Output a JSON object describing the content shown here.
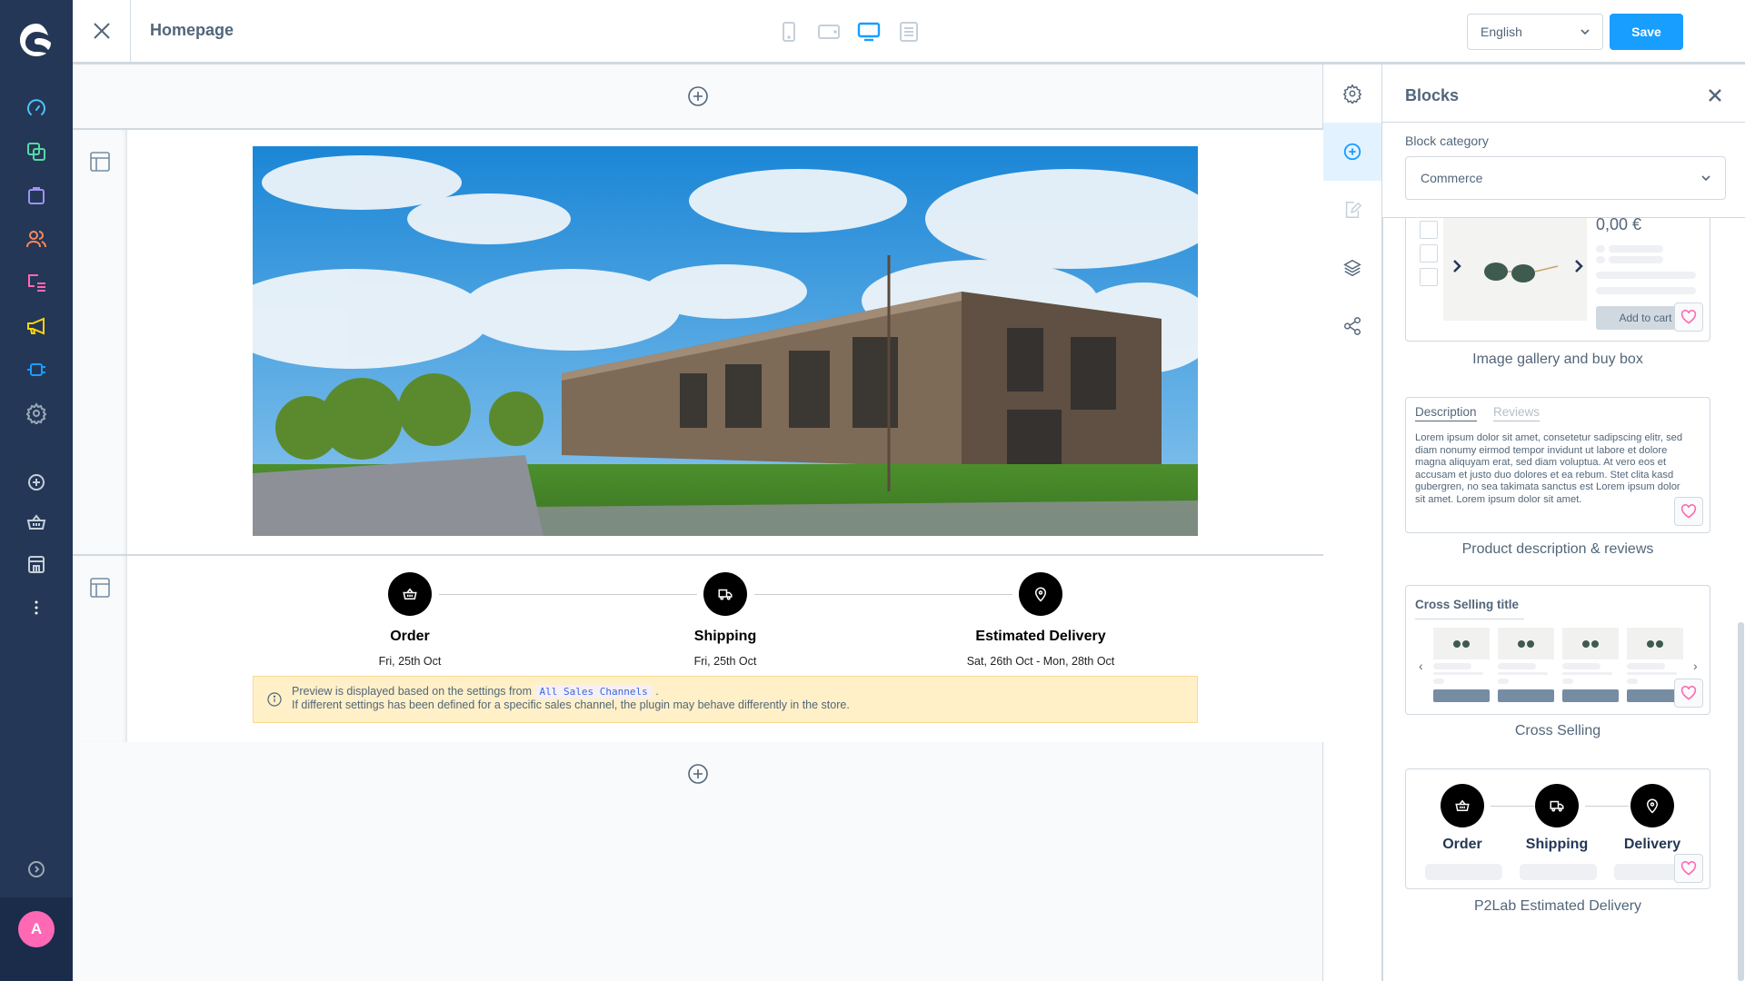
{
  "app": {
    "avatar_initial": "A",
    "brand_color": "#189eff"
  },
  "sidebar": {
    "items": [
      {
        "name": "dashboard",
        "icon": "gauge-icon",
        "color": "#4fc4f7"
      },
      {
        "name": "catalogues",
        "icon": "copy-icon",
        "color": "#57d9a3"
      },
      {
        "name": "orders",
        "icon": "shopping-bag-icon",
        "color": "#a092f0"
      },
      {
        "name": "customers",
        "icon": "users-icon",
        "color": "#ff885b"
      },
      {
        "name": "content",
        "icon": "content-icon",
        "color": "#ff68b4"
      },
      {
        "name": "marketing",
        "icon": "megaphone-icon",
        "color": "#ffd700"
      },
      {
        "name": "extensions",
        "icon": "plug-icon",
        "color": "#189eff"
      },
      {
        "name": "settings",
        "icon": "gear-icon",
        "color": "#9aa8b5"
      }
    ],
    "sales_channels": [
      {
        "name": "add-sales-channel",
        "icon": "plus-circle-icon"
      },
      {
        "name": "headless",
        "icon": "basket-icon"
      },
      {
        "name": "storefront",
        "icon": "storefront-icon"
      },
      {
        "name": "more",
        "icon": "more-vertical-icon"
      }
    ],
    "collapse_icon": "chevron-circle-right-icon"
  },
  "topbar": {
    "title": "Homepage",
    "devices": [
      "mobile",
      "tablet",
      "desktop",
      "form"
    ],
    "active_device": "desktop",
    "language": "English",
    "save_label": "Save"
  },
  "canvas": {
    "timeline": {
      "steps": [
        {
          "label": "Order",
          "date": "Fri, 25th Oct",
          "icon": "basket-icon"
        },
        {
          "label": "Shipping",
          "date": "Fri, 25th Oct",
          "icon": "truck-icon"
        },
        {
          "label": "Estimated Delivery",
          "date": "Sat, 26th Oct - Mon, 28th Oct",
          "icon": "map-pin-icon"
        }
      ]
    },
    "notice": {
      "line1_prefix": "Preview is displayed based on the settings from",
      "channel": "All Sales Channels",
      "line1_suffix": ".",
      "line2": "If different settings has been defined for a specific sales channel, the plugin may behave differently in the store."
    }
  },
  "icon_strip": {
    "items": [
      "gear-icon",
      "plus-circle-icon",
      "edit-icon",
      "layers-icon",
      "share-icon"
    ],
    "active": "plus-circle-icon"
  },
  "panel": {
    "title": "Blocks",
    "category_label": "Block category",
    "category_value": "Commerce",
    "blocks": [
      {
        "name": "Image gallery and buy box",
        "price": "0,00 €",
        "cta": "Add to cart"
      },
      {
        "name": "Product description & reviews",
        "tabs": [
          "Description",
          "Reviews"
        ],
        "text": "Lorem ipsum dolor sit amet, consetetur sadipscing elitr, sed diam nonumy eirmod tempor invidunt ut labore et dolore magna aliquyam erat, sed diam voluptua. At vero eos et accusam et justo duo dolores et ea rebum. Stet clita kasd gubergren, no sea takimata sanctus est Lorem ipsum dolor sit amet. Lorem ipsum dolor sit amet."
      },
      {
        "name": "Cross Selling",
        "title": "Cross Selling title"
      },
      {
        "name": "P2Lab Estimated Delivery",
        "steps": [
          "Order",
          "Shipping",
          "Delivery"
        ]
      }
    ]
  }
}
